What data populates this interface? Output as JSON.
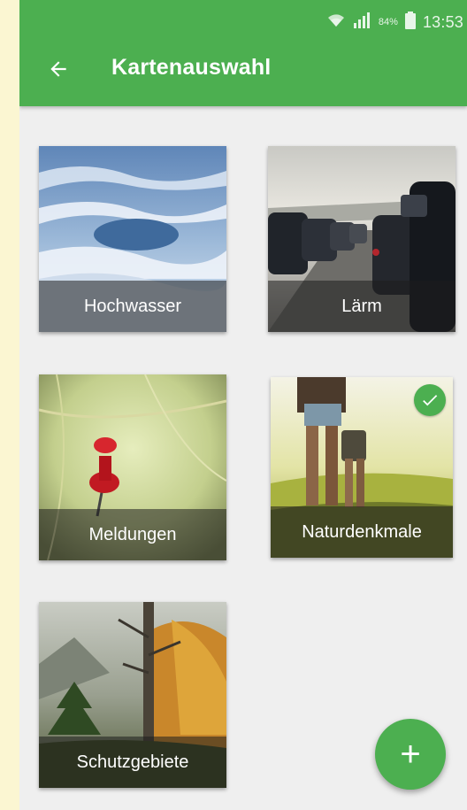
{
  "status_bar": {
    "wifi_icon": "wifi-icon",
    "signal_icon": "signal-icon",
    "battery_percent": "84%",
    "battery_icon": "battery-icon",
    "time": "13:53"
  },
  "app_bar": {
    "back_icon": "arrow-back-icon",
    "title": "Kartenauswahl"
  },
  "cards": [
    {
      "label": "Hochwasser",
      "selected": false
    },
    {
      "label": "Lärm",
      "selected": false
    },
    {
      "label": "Meldungen",
      "selected": false
    },
    {
      "label": "Naturdenkmale",
      "selected": true
    },
    {
      "label": "Schutzgebiete",
      "selected": false
    }
  ],
  "fab": {
    "icon": "plus-icon",
    "symbol": "+"
  },
  "colors": {
    "accent": "#4caf50",
    "background": "#efefef"
  }
}
